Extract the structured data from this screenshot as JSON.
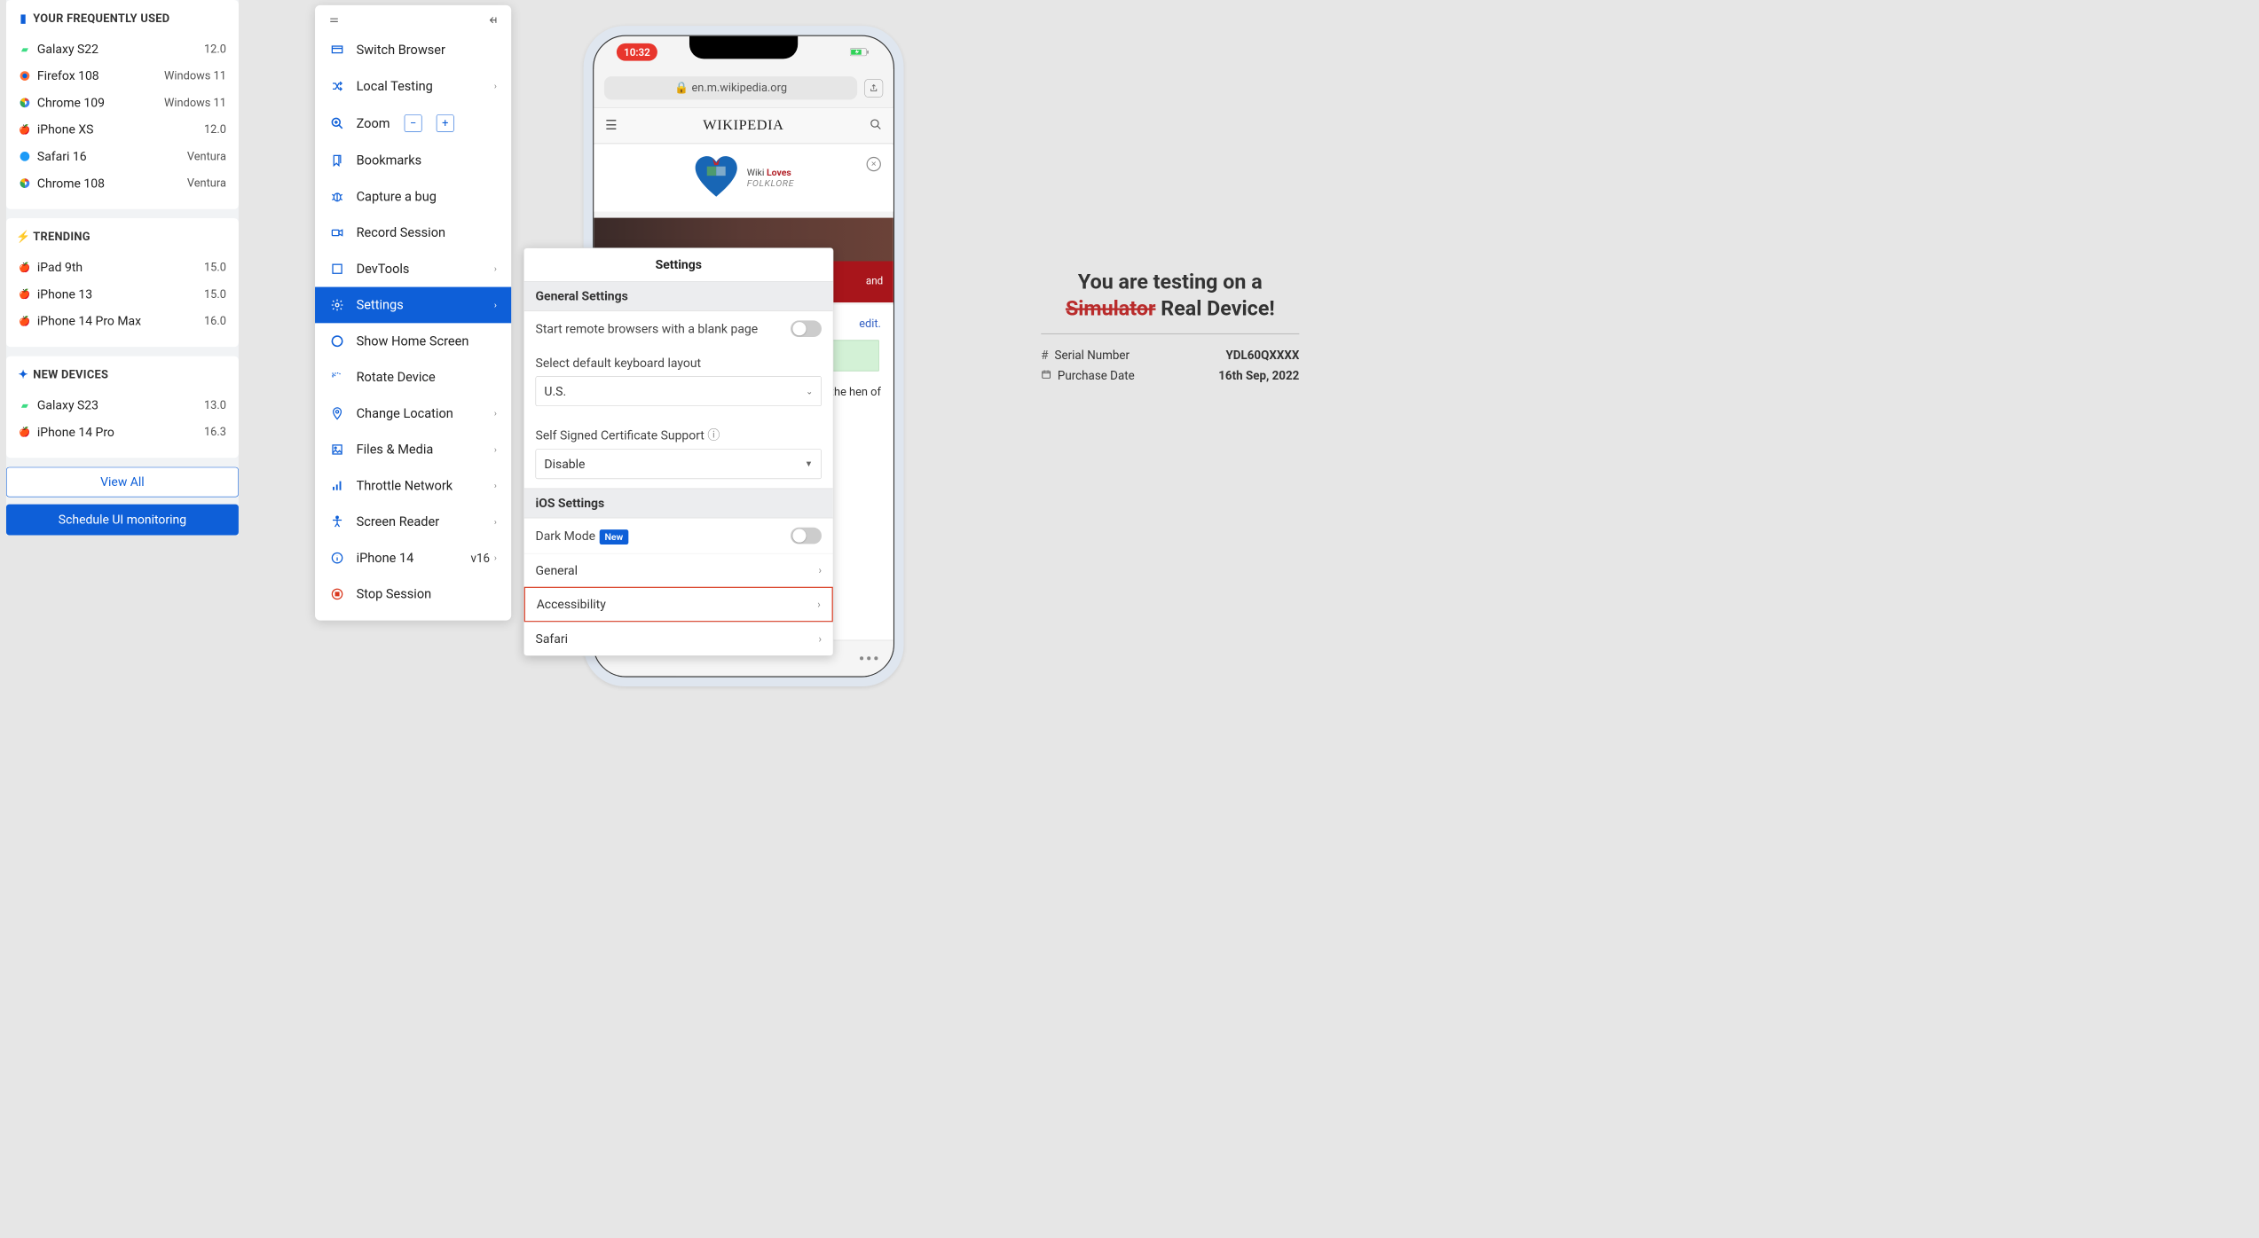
{
  "sidebar": {
    "frequently_used": {
      "title": "YOUR FREQUENTLY USED",
      "items": [
        {
          "icon": "android",
          "name": "Galaxy S22",
          "meta": "12.0"
        },
        {
          "icon": "firefox",
          "name": "Firefox 108",
          "meta": "Windows 11"
        },
        {
          "icon": "chrome",
          "name": "Chrome 109",
          "meta": "Windows 11"
        },
        {
          "icon": "apple",
          "name": "iPhone XS",
          "meta": "12.0"
        },
        {
          "icon": "safari",
          "name": "Safari 16",
          "meta": "Ventura"
        },
        {
          "icon": "chrome",
          "name": "Chrome 108",
          "meta": "Ventura"
        }
      ]
    },
    "trending": {
      "title": "TRENDING",
      "items": [
        {
          "icon": "apple",
          "name": "iPad 9th",
          "meta": "15.0"
        },
        {
          "icon": "apple",
          "name": "iPhone 13",
          "meta": "15.0"
        },
        {
          "icon": "apple",
          "name": "iPhone 14 Pro Max",
          "meta": "16.0"
        }
      ]
    },
    "new_devices": {
      "title": "NEW DEVICES",
      "items": [
        {
          "icon": "android",
          "name": "Galaxy S23",
          "meta": "13.0"
        },
        {
          "icon": "apple",
          "name": "iPhone 14 Pro",
          "meta": "16.3"
        }
      ]
    },
    "view_all": "View All",
    "schedule": "Schedule UI monitoring"
  },
  "toolbar": {
    "items": [
      {
        "icon": "browser",
        "label": "Switch Browser",
        "chev": false
      },
      {
        "icon": "shuffle",
        "label": "Local Testing",
        "chev": true
      },
      {
        "icon": "zoom",
        "label": "Zoom",
        "zoom_controls": true
      },
      {
        "icon": "bookmark",
        "label": "Bookmarks",
        "chev": false
      },
      {
        "icon": "bug",
        "label": "Capture a bug",
        "chev": false
      },
      {
        "icon": "video",
        "label": "Record Session",
        "chev": false
      },
      {
        "icon": "devtools",
        "label": "DevTools",
        "chev": true
      },
      {
        "icon": "gear",
        "label": "Settings",
        "chev": true,
        "active": true
      },
      {
        "icon": "circle",
        "label": "Show Home Screen",
        "chev": false
      },
      {
        "icon": "rotate",
        "label": "Rotate Device",
        "chev": false
      },
      {
        "icon": "pin",
        "label": "Change Location",
        "chev": true
      },
      {
        "icon": "image",
        "label": "Files & Media",
        "chev": true
      },
      {
        "icon": "throttle",
        "label": "Throttle Network",
        "chev": true
      },
      {
        "icon": "accessibility",
        "label": "Screen Reader",
        "chev": true
      },
      {
        "icon": "info",
        "label": "iPhone 14",
        "meta": "v16",
        "chev": true
      },
      {
        "icon": "stop",
        "label": "Stop Session",
        "chev": false
      }
    ]
  },
  "settings": {
    "title": "Settings",
    "general_header": "General Settings",
    "blank_page_label": "Start remote browsers with a blank page",
    "keyboard_label": "Select default keyboard layout",
    "keyboard_value": "U.S.",
    "cert_label": "Self Signed Certificate Support",
    "cert_value": "Disable",
    "ios_header": "iOS Settings",
    "dark_mode_label": "Dark Mode",
    "new_badge": "New",
    "general_link": "General",
    "accessibility_link": "Accessibility",
    "safari_link": "Safari"
  },
  "phone": {
    "time": "10:32",
    "url": "en.m.wikipedia.org",
    "wiki_logo": "WIKIPEDIA",
    "banner_l1": "Wiki",
    "banner_l2": "Loves",
    "banner_l3": "FOLKLORE",
    "content_edit": "edit.",
    "content_and": "and",
    "content_body": "Arab ary the e. He in the hen of"
  },
  "info": {
    "title_l1": "You are testing on a",
    "title_strike": "Simulator",
    "title_l2": "Real Device!",
    "serial_label": "Serial Number",
    "serial_value": "YDL60QXXXX",
    "purchase_label": "Purchase Date",
    "purchase_value": "16th Sep, 2022"
  }
}
